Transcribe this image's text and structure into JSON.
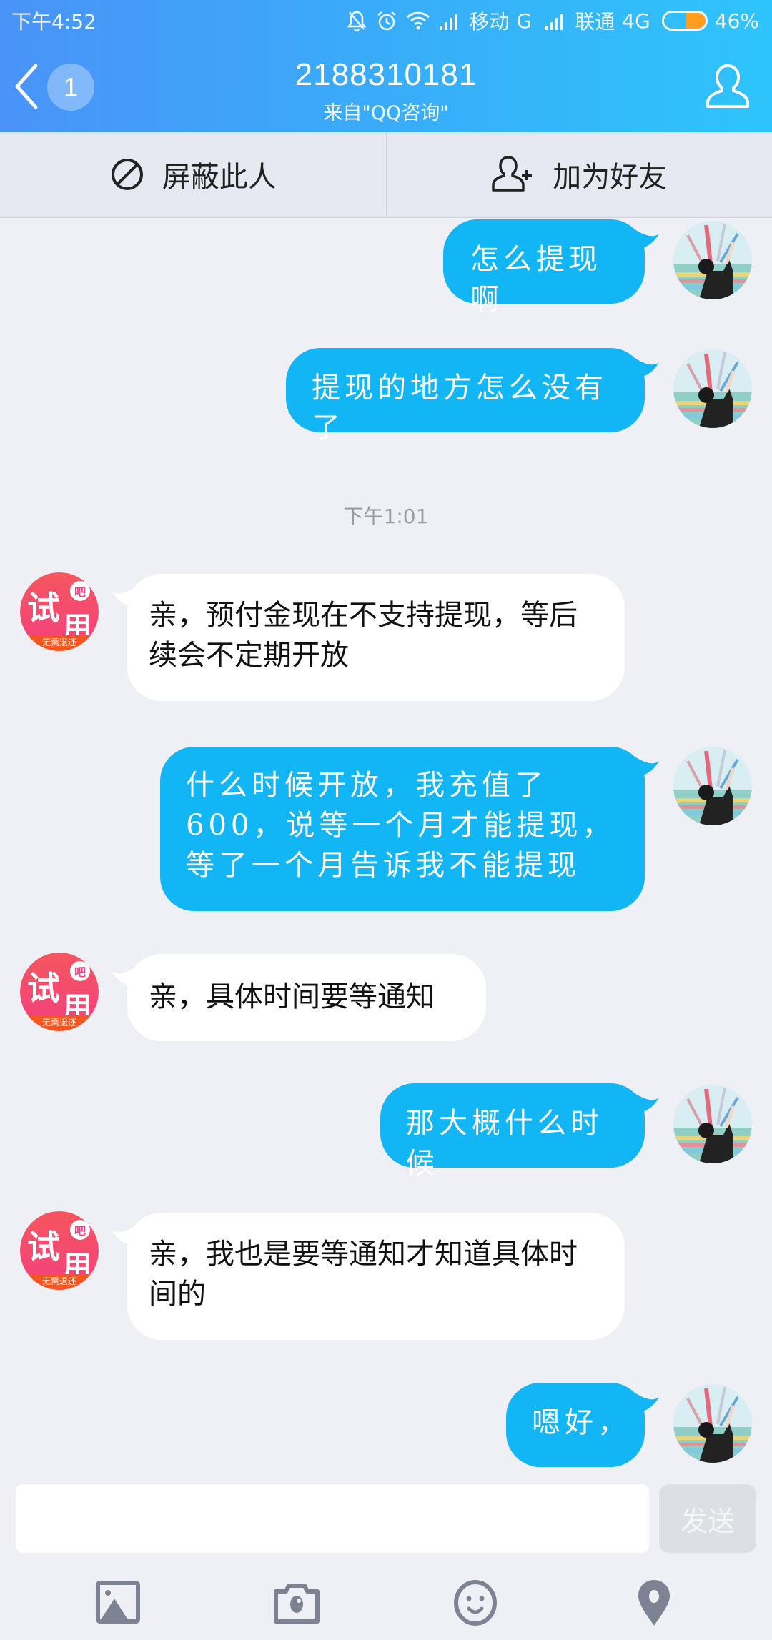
{
  "status_bar": {
    "time": "下午4:52",
    "carrier1": "移动",
    "net1": "G",
    "carrier2": "联通",
    "net2": "4G",
    "battery_percent_label": "46%",
    "battery_level": 0.46,
    "icons": [
      "mute-icon",
      "alarm-icon",
      "wifi-icon",
      "signal-icon",
      "signal-icon",
      "battery-icon"
    ]
  },
  "header": {
    "unread_count": "1",
    "title": "2188310181",
    "subtitle": "来自\"QQ咨询\"",
    "back_icon": "chevron-left-icon",
    "profile_icon": "person-icon"
  },
  "actions": {
    "block_label": "屏蔽此人",
    "add_friend_label": "加为好友"
  },
  "colors": {
    "header_gradient_start": "#4a93f8",
    "header_gradient_end": "#2ec4fb",
    "outgoing_bubble": "#12b6f5",
    "incoming_bubble": "#ffffff",
    "chat_background": "#eff0f5",
    "icon_gray": "#7e8293"
  },
  "messages": [
    {
      "from": "me",
      "text": "怎么提现啊"
    },
    {
      "from": "me",
      "text": "提现的地方怎么没有了"
    },
    {
      "type": "timestamp",
      "text": "下午1:01"
    },
    {
      "from": "them",
      "text": "亲，预付金现在不支持提现，等后续会不定期开放"
    },
    {
      "from": "me",
      "text": "什么时候开放，我充值了600，说等一个月才能提现，等了一个月告诉我不能提现"
    },
    {
      "from": "them",
      "text": "亲，具体时间要等通知"
    },
    {
      "from": "me",
      "text": "那大概什么时候"
    },
    {
      "from": "them",
      "text": "亲，我也是要等通知才知道具体时间的"
    },
    {
      "from": "me",
      "text": "嗯好，"
    }
  ],
  "them_avatar": {
    "line1": "试",
    "line2": "用",
    "badge": "吧",
    "banner": "无需退还"
  },
  "input": {
    "value": "",
    "placeholder": "",
    "send_label": "发送"
  },
  "toolbar": [
    "image-icon",
    "camera-icon",
    "emoji-icon",
    "location-icon"
  ]
}
